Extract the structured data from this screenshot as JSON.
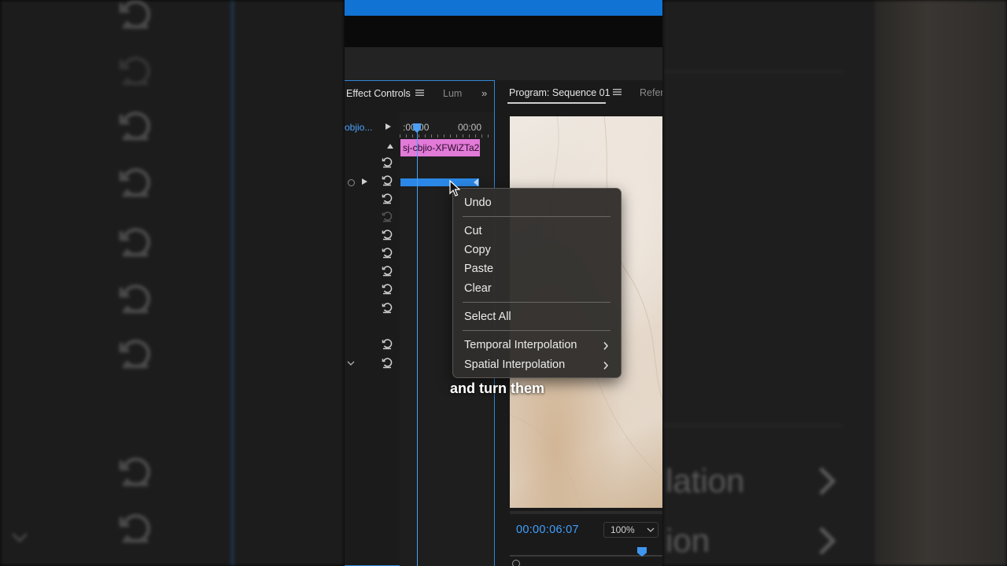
{
  "effect_controls": {
    "tab_label": "Effect Controls",
    "lumetri_tab": "Lum",
    "more": "»",
    "clip_name": "objio...",
    "time_start": ":00:00",
    "time_end": "00:00",
    "clip_bar_label": "sj-cbjio-XFWiZTa2"
  },
  "program": {
    "tab_label": "Program: Sequence 01",
    "reference_tab": "Refer",
    "timecode": "00:00:06:07",
    "zoom": "100%"
  },
  "context_menu": {
    "items": [
      {
        "label": "Undo"
      },
      {
        "label": "Cut"
      },
      {
        "label": "Copy"
      },
      {
        "label": "Paste"
      },
      {
        "label": "Clear"
      },
      {
        "label": "Select All"
      },
      {
        "label": "Temporal Interpolation",
        "submenu": true
      },
      {
        "label": "Spatial Interpolation",
        "submenu": true
      }
    ]
  },
  "caption": "and turn them",
  "background": {
    "ghost_1": "lation",
    "ghost_2": "ion"
  },
  "colors": {
    "accent": "#1173d4",
    "timecode": "#3fa0ff",
    "clip": "#e27ad8"
  }
}
